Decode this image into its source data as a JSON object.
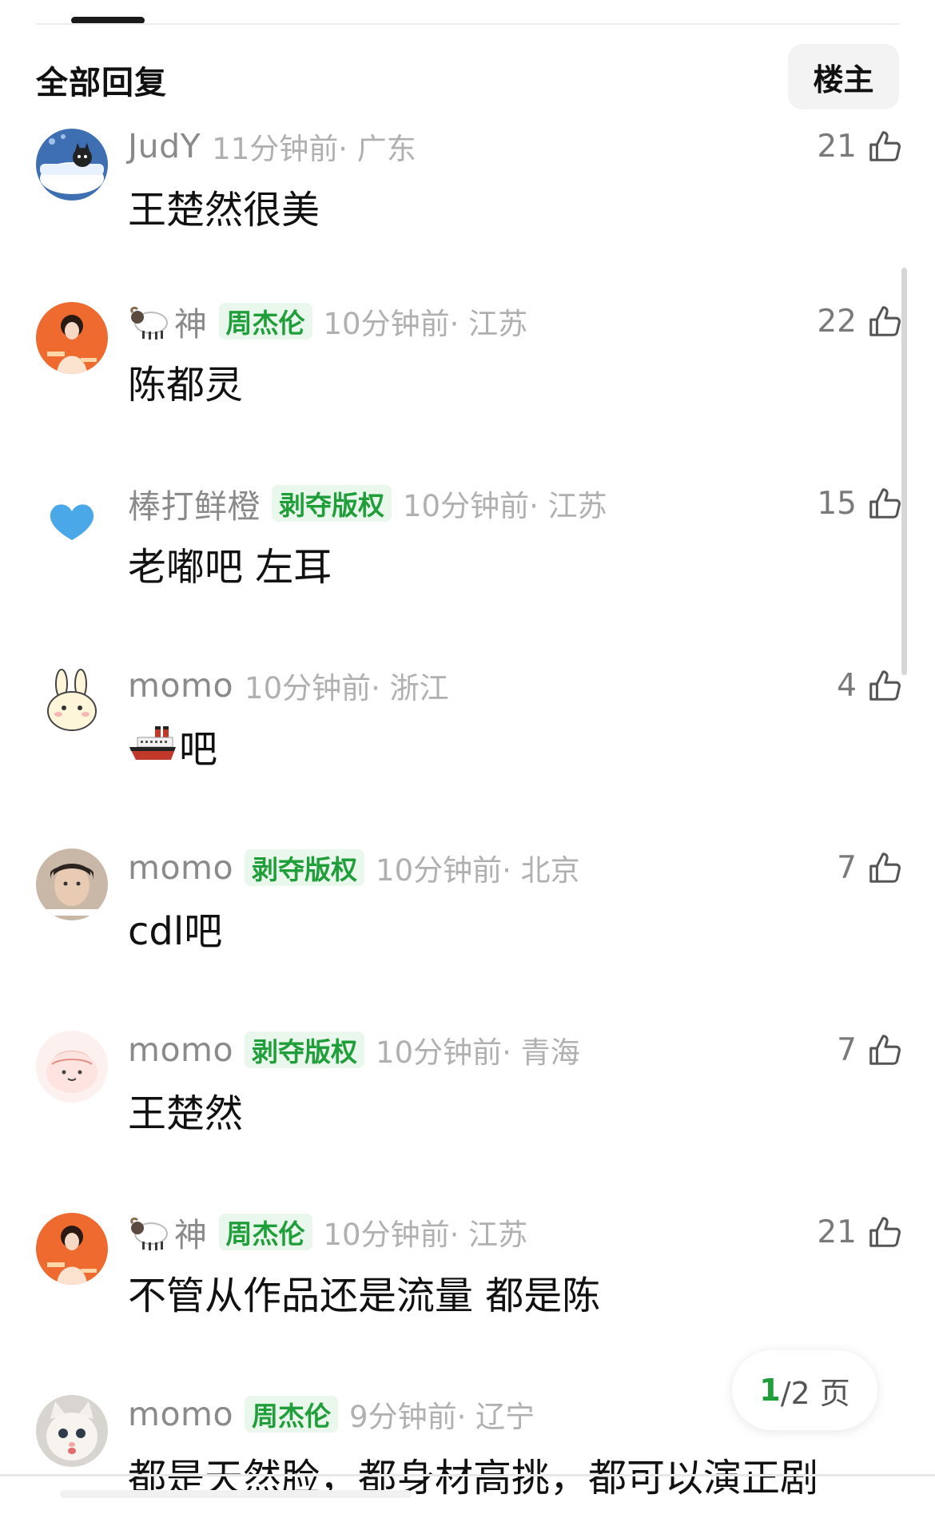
{
  "header": {
    "title": "全部回复",
    "owner_button": "楼主"
  },
  "comments": [
    {
      "username": "JudY",
      "badge": "",
      "time": "11分钟前",
      "location": " · 广东",
      "likes": "21",
      "text": "王楚然很美",
      "avatar": "cat-in-bathtub"
    },
    {
      "username": "神",
      "badge": "周杰伦",
      "time": "10分钟前",
      "location": " · 江苏",
      "likes": "22",
      "text": "陈都灵",
      "avatar": "girl-orange-poster"
    },
    {
      "username": "棒打鲜橙",
      "badge": "剥夺版权",
      "time": "10分钟前",
      "location": " · 江苏",
      "likes": "15",
      "text": "老嘟吧 左耳",
      "avatar": "blue-heart"
    },
    {
      "username": "momo",
      "badge": "",
      "time": "10分钟前",
      "location": " · 浙江",
      "likes": "4",
      "text": "吧",
      "avatar": "rabbit-cartoon"
    },
    {
      "username": "momo",
      "badge": "剥夺版权",
      "time": "10分钟前",
      "location": " · 北京",
      "likes": "7",
      "text": "cdl吧",
      "avatar": "boy-photo"
    },
    {
      "username": "momo",
      "badge": "剥夺版权",
      "time": "10分钟前",
      "location": " · 青海",
      "likes": "7",
      "text": "王楚然",
      "avatar": "pink-blob"
    },
    {
      "username": "神",
      "badge": "周杰伦",
      "time": "10分钟前",
      "location": " · 江苏",
      "likes": "21",
      "text": "不管从作品还是流量 都是陈",
      "avatar": "girl-orange-poster"
    },
    {
      "username": "momo",
      "badge": "周杰伦",
      "time": "9分钟前",
      "location": " · 辽宁",
      "likes": "",
      "text": "都是天然脸，都身材高挑，都可以演正剧",
      "avatar": "white-cat"
    }
  ],
  "pagination": {
    "current": "1",
    "rest": "/2 页"
  },
  "colors": {
    "badge_green": "#1f9e3a",
    "badge_bg": "#eaf7ec",
    "meta_gray": "#b0b0b0",
    "name_gray": "#8a8a8a"
  }
}
